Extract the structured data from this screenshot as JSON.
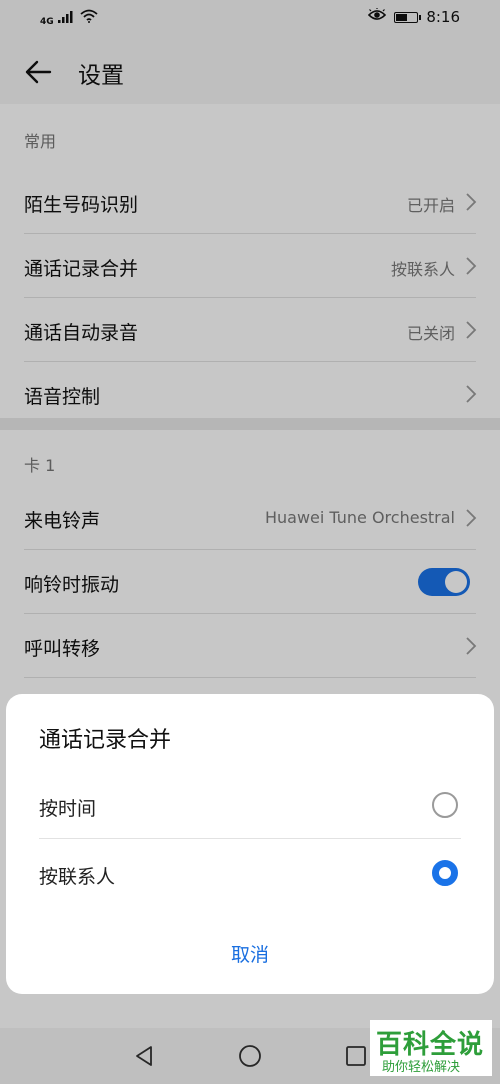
{
  "status_bar": {
    "network": "4G",
    "time": "8:16",
    "battery_level": 0.6
  },
  "header": {
    "title": "设置"
  },
  "sections": [
    {
      "title": "常用",
      "rows": [
        {
          "label": "陌生号码识别",
          "value": "已开启"
        },
        {
          "label": "通话记录合并",
          "value": "按联系人"
        },
        {
          "label": "通话自动录音",
          "value": "已关闭"
        },
        {
          "label": "语音控制",
          "value": ""
        }
      ]
    },
    {
      "title": "卡 1",
      "rows": [
        {
          "label": "来电铃声",
          "value": "Huawei Tune Orchestral"
        },
        {
          "label": "响铃时振动",
          "toggle": true
        },
        {
          "label": "呼叫转移",
          "value": ""
        }
      ]
    }
  ],
  "dialog": {
    "title": "通话记录合并",
    "options": [
      {
        "label": "按时间",
        "selected": false
      },
      {
        "label": "按联系人",
        "selected": true
      }
    ],
    "cancel_label": "取消"
  },
  "watermark": {
    "logo": "百科全说",
    "tagline": "助你轻松解决"
  },
  "colors": {
    "accent": "#1a73e8",
    "watermark": "#2e9e3a"
  }
}
